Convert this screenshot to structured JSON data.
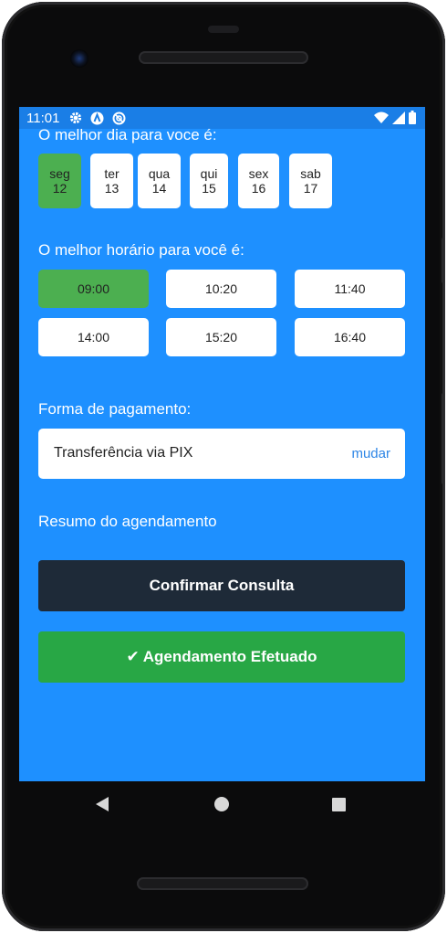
{
  "status_bar": {
    "time": "11:01",
    "icons": [
      "gear-icon",
      "app-a-icon",
      "app-no-disturb-icon",
      "wifi-icon",
      "signal-icon",
      "battery-icon"
    ]
  },
  "days_section": {
    "label": "O melhor dia para voce é:",
    "days": [
      {
        "weekday": "seg",
        "day": "12",
        "selected": true
      },
      {
        "weekday": "ter",
        "day": "13",
        "selected": false
      },
      {
        "weekday": "qua",
        "day": "14",
        "selected": false
      },
      {
        "weekday": "qui",
        "day": "15",
        "selected": false
      },
      {
        "weekday": "sex",
        "day": "16",
        "selected": false
      },
      {
        "weekday": "sab",
        "day": "17",
        "selected": false
      }
    ]
  },
  "times_section": {
    "label": "O melhor horário para você é:",
    "times": [
      {
        "label": "09:00",
        "selected": true
      },
      {
        "label": "10:20",
        "selected": false
      },
      {
        "label": "11:40",
        "selected": false
      },
      {
        "label": "14:00",
        "selected": false
      },
      {
        "label": "15:20",
        "selected": false
      },
      {
        "label": "16:40",
        "selected": false
      }
    ]
  },
  "payment": {
    "label": "Forma de pagamento:",
    "method": "Transferência via PIX",
    "change_link": "mudar"
  },
  "summary": {
    "label": "Resumo do agendamento"
  },
  "buttons": {
    "confirm": "Confirmar Consulta",
    "done_check": "✔",
    "done": "Agendamento Efetuado"
  },
  "colors": {
    "background": "#1e90ff",
    "selected": "#4caf50",
    "confirm_button": "#1e2a38",
    "done_button": "#28a745",
    "link": "#2e86e6"
  }
}
